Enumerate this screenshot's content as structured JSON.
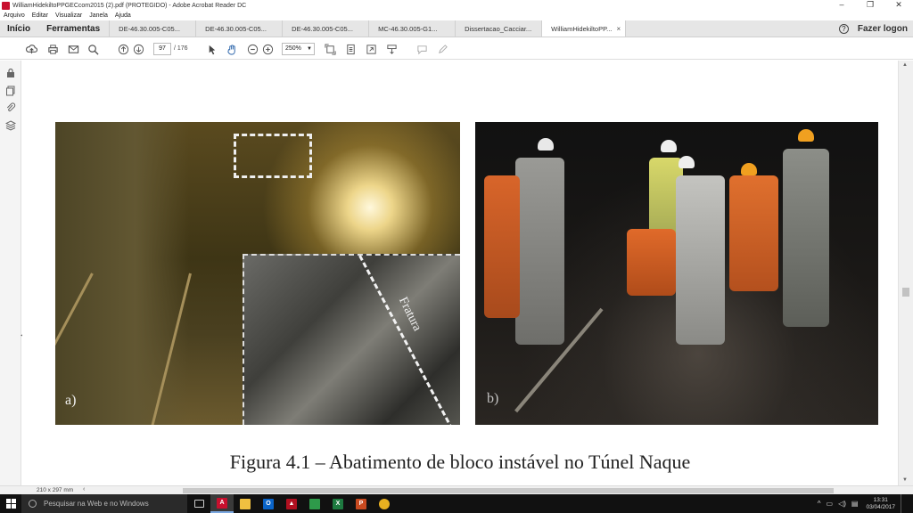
{
  "window": {
    "title": "WilliamHidekiltoPPGECcom2015 (2).pdf (PROTEGIDO) - Adobe Acrobat Reader DC",
    "controls": [
      "–",
      "❐",
      "✕"
    ]
  },
  "menu": {
    "items": [
      "Arquivo",
      "Editar",
      "Visualizar",
      "Janela",
      "Ajuda"
    ]
  },
  "tabs": {
    "home": "Início",
    "tools": "Ferramentas",
    "docs": [
      "DE-46.30.005-C05...",
      "DE-46.30.005-C05...",
      "DE-46.30.005-C05...",
      "MC-46.30.005-G1...",
      "Dissertacao_Cacciar..."
    ],
    "active_doc": "WilliamHidekiltoPP...",
    "close_glyph": "×",
    "help_glyph": "?",
    "login": "Fazer logon"
  },
  "toolbar": {
    "icons": [
      "upload-cloud-icon",
      "print-icon",
      "email-icon",
      "search-icon",
      "previous-page-icon",
      "next-page-icon",
      "select-cursor-icon",
      "hand-tool-icon",
      "zoom-out-icon",
      "zoom-in-icon",
      "fit-page-icon",
      "scroll-mode-icon",
      "full-screen-icon",
      "read-mode-icon",
      "comment-icon",
      "pen-icon"
    ],
    "page_current": "97",
    "page_total": "/ 176",
    "zoom": "250%"
  },
  "document": {
    "label_a": "a)",
    "label_b": "b)",
    "inset_label": "Fratura",
    "caption": "Figura 4.1 – Abatimento de bloco instável no Túnel Naque",
    "page_size": "210 x 297 mm"
  },
  "taskbar": {
    "search_placeholder": "Pesquisar na Web e no Windows",
    "apps": [
      "task-view-icon",
      "acrobat-icon",
      "file-explorer-icon",
      "outlook-icon",
      "acrobat-dc-icon",
      "maps-icon",
      "excel-icon",
      "powerpoint-icon",
      "chrome-icon"
    ],
    "time": "13:31",
    "date": "03/04/2017"
  },
  "colors": {
    "acrobat_red": "#c8102e",
    "taskbar": "#111111",
    "tab_bg": "#e6e6e6"
  }
}
